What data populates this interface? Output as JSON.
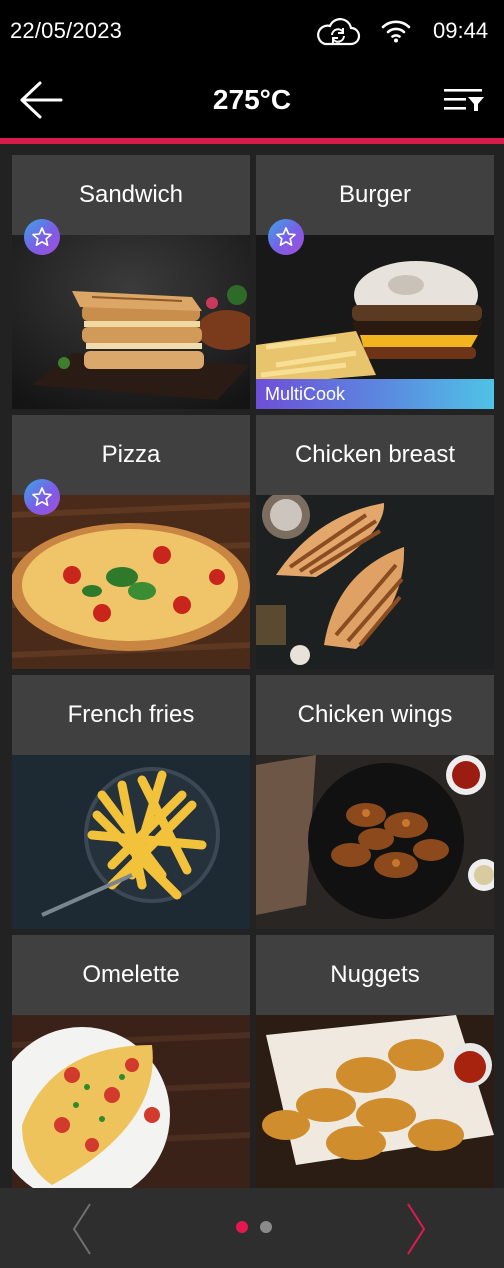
{
  "status": {
    "date": "22/05/2023",
    "time": "09:44",
    "icons": [
      "cloud-sync-icon",
      "wifi-icon"
    ]
  },
  "header": {
    "title": "275°C",
    "back_icon": "arrow-left-icon",
    "filter_icon": "filter-sort-icon"
  },
  "recipes": [
    {
      "name": "Sandwich",
      "favorite": true,
      "multicook": false
    },
    {
      "name": "Burger",
      "favorite": true,
      "multicook": true
    },
    {
      "name": "Pizza",
      "favorite": true,
      "multicook": false
    },
    {
      "name": "Chicken breast",
      "favorite": false,
      "multicook": false
    },
    {
      "name": "French fries",
      "favorite": false,
      "multicook": false
    },
    {
      "name": "Chicken wings",
      "favorite": false,
      "multicook": false
    },
    {
      "name": "Omelette",
      "favorite": false,
      "multicook": false
    },
    {
      "name": "Nuggets",
      "favorite": false,
      "multicook": false
    }
  ],
  "badges": {
    "multicook_label": "MultiCook"
  },
  "pagination": {
    "current_page": 1,
    "total_pages": 2
  },
  "colors": {
    "accent": "#d81b49",
    "background": "#222222",
    "card_title_bg": "#404040",
    "active_dot": "#e3184f",
    "inactive_dot": "#8a8a8a"
  }
}
